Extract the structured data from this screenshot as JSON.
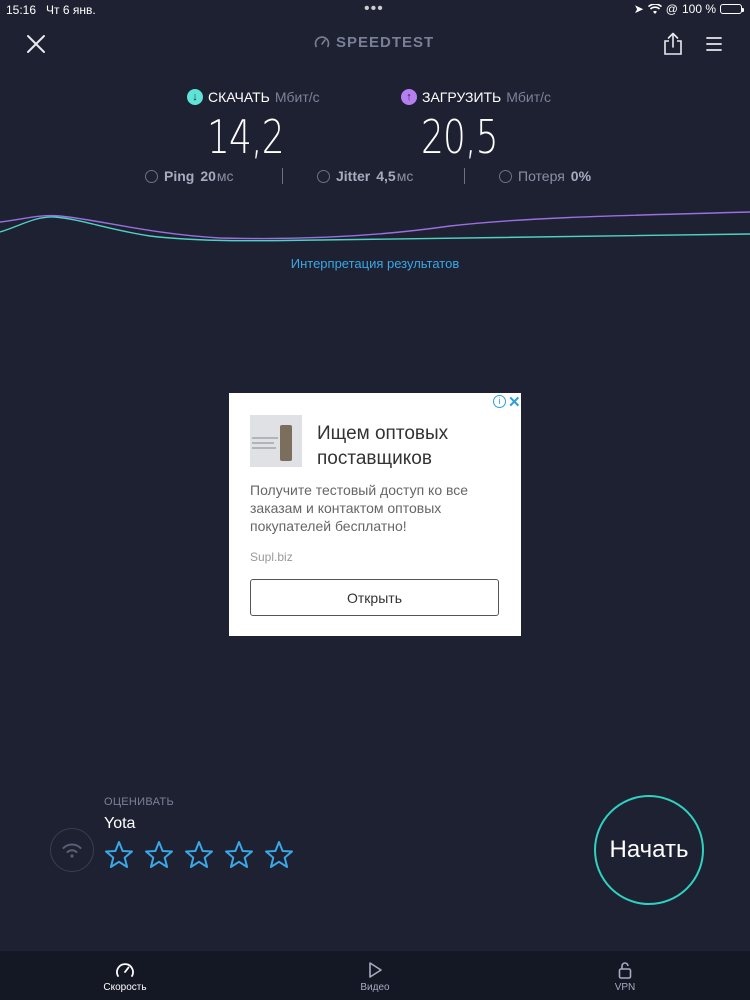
{
  "status_bar": {
    "time": "15:16",
    "date": "Чт 6 янв.",
    "battery": "100 %"
  },
  "header": {
    "title": "SPEEDTEST"
  },
  "download": {
    "label": "СКАЧАТЬ",
    "unit": "Мбит/с",
    "value": "14,2"
  },
  "upload": {
    "label": "ЗАГРУЗИТЬ",
    "unit": "Мбит/с",
    "value": "20,5"
  },
  "ping": {
    "label": "Ping",
    "value": "20",
    "unit": "мс"
  },
  "jitter": {
    "label": "Jitter",
    "value": "4,5",
    "unit": "мс"
  },
  "loss": {
    "label": "Потеря",
    "value": "0%"
  },
  "interpretation_link": "Интерпретация результатов",
  "ad": {
    "title": "Ищем оптовых поставщиков",
    "body": "Получите тестовый доступ ко все заказам и контактом оптовых покупателей бесплатно!",
    "domain": "Supl.biz",
    "button": "Открыть"
  },
  "rating": {
    "label": "ОЦЕНИВАТЬ",
    "provider": "Yota",
    "stars": 5
  },
  "start_button": "Начать",
  "tabs": [
    {
      "label": "Скорость",
      "icon": "speedometer-icon",
      "active": true
    },
    {
      "label": "Видео",
      "icon": "play-icon",
      "active": false
    },
    {
      "label": "VPN",
      "icon": "lock-icon",
      "active": false
    }
  ],
  "colors": {
    "background": "#1e2132",
    "download": "#5fe3d6",
    "upload": "#b67ef0",
    "link": "#3aa7e6"
  }
}
